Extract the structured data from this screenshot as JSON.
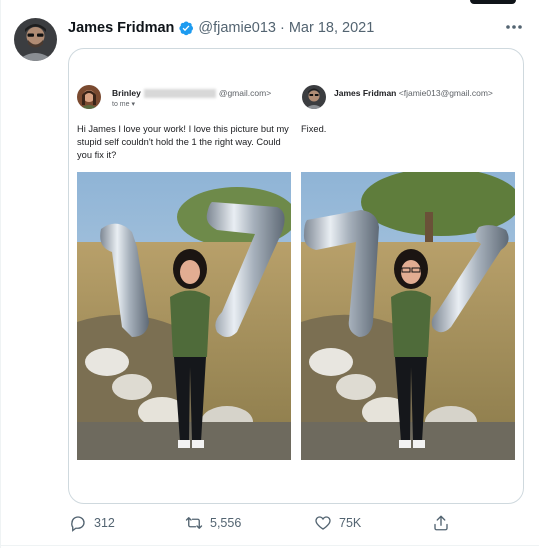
{
  "tweet": {
    "author_name": "James Fridman",
    "handle": "@fjamie013",
    "separator": "·",
    "date": "Mar 18, 2021",
    "more_label": "•••"
  },
  "email": {
    "left": {
      "sender_name": "Brinley",
      "sender_email": "@gmail.com>",
      "to_me": "to me ▾",
      "body": "Hi James I love your work! I love this picture but my stupid self couldn't hold the 1 the right way. Could you fix it?"
    },
    "right": {
      "sender_name": "James Fridman",
      "sender_email": "<fjamie013@gmail.com>",
      "body": "Fixed."
    }
  },
  "actions": {
    "replies": "312",
    "retweets": "5,556",
    "likes": "75K"
  },
  "colors": {
    "verified": "#1d9bf0",
    "secondary_text": "#536471",
    "border": "#cfd9de"
  }
}
